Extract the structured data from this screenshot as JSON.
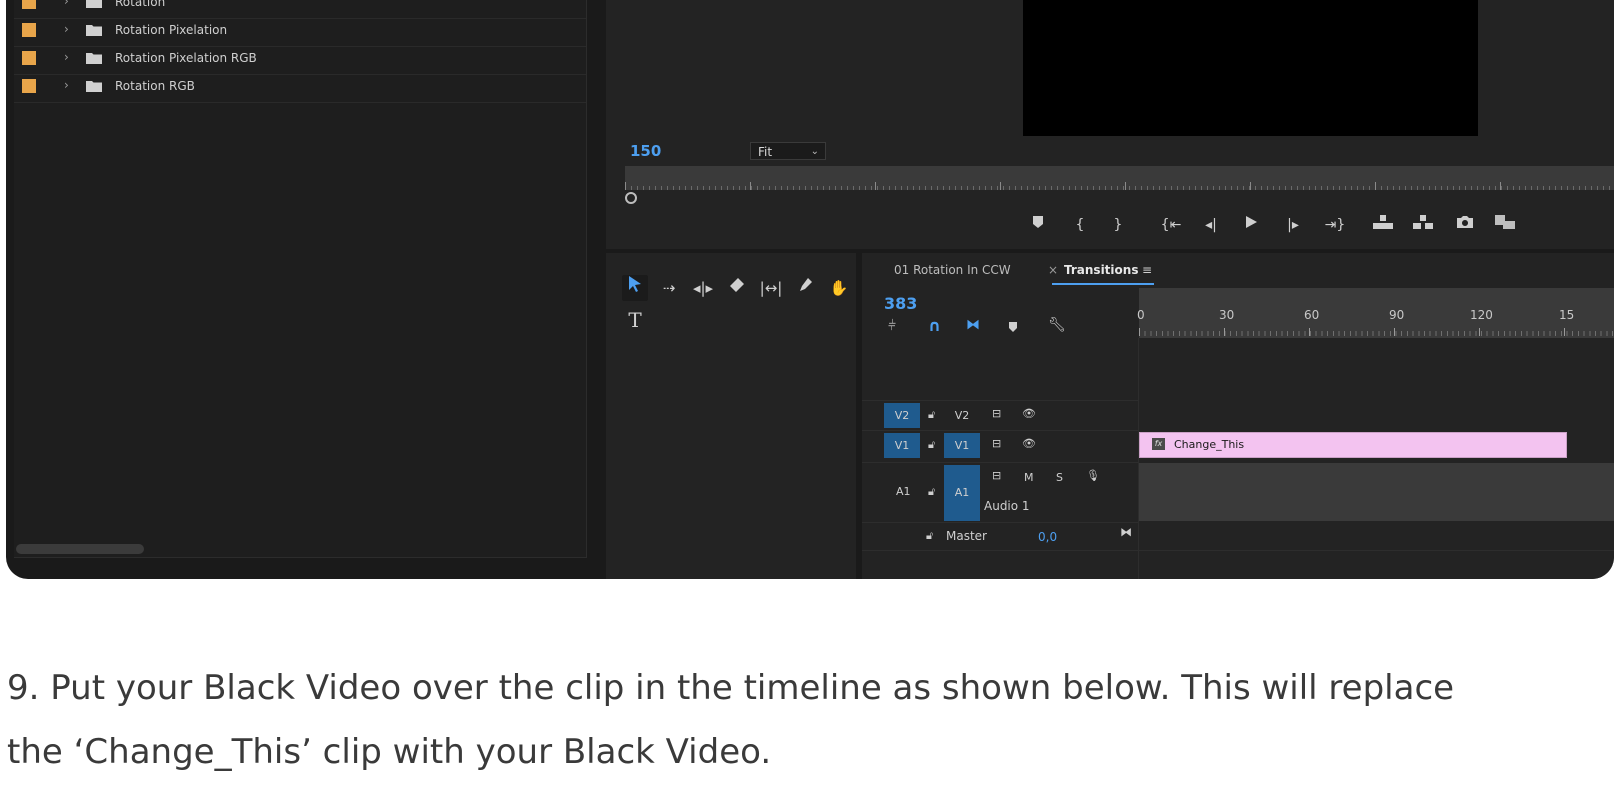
{
  "project_panel": {
    "items": [
      {
        "label": "Rotation"
      },
      {
        "label": "Rotation Pixelation"
      },
      {
        "label": "Rotation Pixelation RGB"
      },
      {
        "label": "Rotation RGB"
      }
    ]
  },
  "monitor": {
    "timecode": "150",
    "zoom": "Fit"
  },
  "timeline": {
    "tabs": {
      "sequence": "01 Rotation In CCW",
      "close": "×",
      "active": "Transitions",
      "menu": "≡"
    },
    "timecode": "383",
    "ruler_labels": [
      "0",
      "30",
      "60",
      "90",
      "120",
      "15"
    ],
    "tracks": {
      "v2": {
        "source": "V2",
        "target": "V2"
      },
      "v1": {
        "source": "V1",
        "target": "V1"
      },
      "a1": {
        "source": "A1",
        "target": "A1",
        "name": "Audio 1",
        "mute": "M",
        "solo": "S"
      },
      "master": {
        "label": "Master",
        "value": "0,0"
      }
    },
    "clip": {
      "name": "Change_This",
      "fx": "fx"
    }
  },
  "tools": {
    "type_label": "T"
  },
  "instruction": {
    "line1": "9. Put your Black Video over the clip in the timeline as shown below. This will replace",
    "line2": "the ‘Change_This’ clip with your Black Video."
  },
  "colors": {
    "label_orange": "#e8a54a",
    "accent_blue": "#4d9ff0",
    "track_blue": "#1f5b8e",
    "clip_pink": "#f3c3f0"
  }
}
